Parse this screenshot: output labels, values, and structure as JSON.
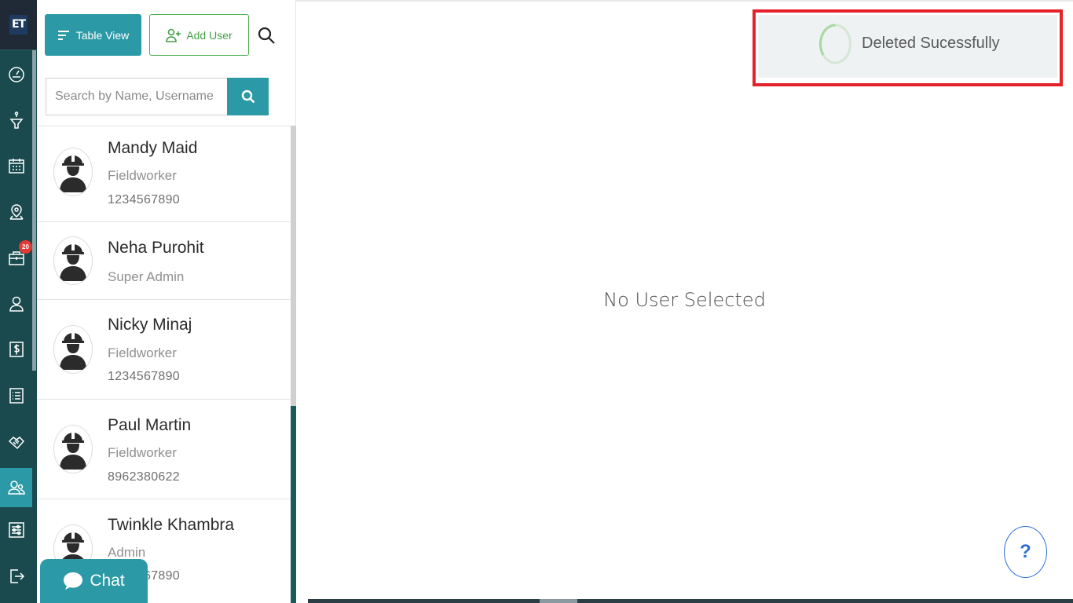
{
  "app": {
    "logo_text": "ET"
  },
  "rail": {
    "items": [
      {
        "icon": "dashboard-gauge-icon"
      },
      {
        "icon": "funnel-icon"
      },
      {
        "icon": "calendar-icon"
      },
      {
        "icon": "map-pin-icon"
      },
      {
        "icon": "briefcase-icon",
        "badge": "20"
      },
      {
        "icon": "person-icon"
      },
      {
        "icon": "dollar-icon"
      },
      {
        "icon": "list-icon"
      },
      {
        "icon": "handshake-icon"
      },
      {
        "icon": "users-icon",
        "active": true
      },
      {
        "icon": "settings-sliders-icon"
      },
      {
        "icon": "logout-icon"
      }
    ]
  },
  "toolbar": {
    "table_view_label": "Table View",
    "add_user_label": "Add User"
  },
  "search": {
    "placeholder": "Search by Name, Username"
  },
  "users": [
    {
      "name": "Mandy Maid",
      "role": "Fieldworker",
      "phone": "1234567890"
    },
    {
      "name": "Neha Purohit",
      "role": "Super Admin",
      "phone": ""
    },
    {
      "name": "Nicky Minaj",
      "role": "Fieldworker",
      "phone": "1234567890"
    },
    {
      "name": "Paul Martin",
      "role": "Fieldworker",
      "phone": "8962380622"
    },
    {
      "name": "Twinkle Khambra",
      "role": "Admin",
      "phone": "1234567890"
    }
  ],
  "main": {
    "empty_message": "No User Selected"
  },
  "toast": {
    "message": "Deleted Sucessfully",
    "highlight_color": "#e5212a"
  },
  "help": {
    "label": "?"
  },
  "chat": {
    "label": "Chat"
  },
  "colors": {
    "accent": "#2b9aa6",
    "rail_bg": "#1a4a4e",
    "add_user_green": "#43a047",
    "badge_red": "#e53935"
  }
}
